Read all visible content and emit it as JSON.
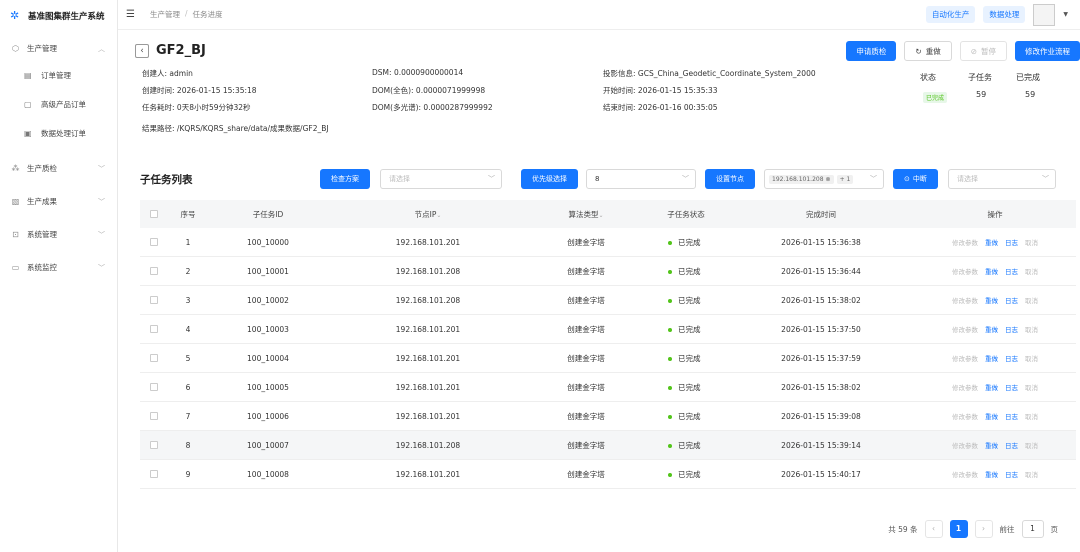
{
  "app": {
    "name": "基准图集群生产系统"
  },
  "sidebar": {
    "items": [
      {
        "label": "生产管理",
        "expanded": true,
        "children": [
          {
            "label": "订单管理"
          },
          {
            "label": "高级产品订单"
          },
          {
            "label": "数据处理订单"
          }
        ]
      },
      {
        "label": "生产质检"
      },
      {
        "label": "生产成果"
      },
      {
        "label": "系统管理"
      },
      {
        "label": "系统监控"
      }
    ]
  },
  "topbar": {
    "breadcrumb": [
      "生产管理",
      "任务进度"
    ],
    "separator": "/",
    "auto_produce": "自动化生产",
    "data_process": "数据处理"
  },
  "task": {
    "title": "GF2_BJ",
    "actions": {
      "apply_qc": "申请质检",
      "reset": "重做",
      "pause": "暂停",
      "modify": "修改作业流程"
    },
    "info": {
      "creator_label": "创建人:",
      "creator": "admin",
      "dsm_label": "DSM:",
      "dsm": "0.0000900000014",
      "proj_label": "投影信息:",
      "proj": "GCS_China_Geodetic_Coordinate_System_2000",
      "created_label": "创建时间:",
      "created": "2026-01-15 15:35:18",
      "dom_pan_label": "DOM(全色):",
      "dom_pan": "0.0000071999998",
      "start_label": "开始时间:",
      "start": "2026-01-15 15:35:33",
      "duration_label": "任务耗时:",
      "duration": "0天8小时59分钟32秒",
      "dom_ms_label": "DOM(多光谱):",
      "dom_ms": "0.0000287999992",
      "end_label": "结束时间:",
      "end": "2026-01-16 00:35:05",
      "result_label": "结果路径:",
      "result": "/KQRS/KQRS_share/data/成果数据/GF2_BJ"
    },
    "stats": {
      "status_label": "状态",
      "status": "已完成",
      "sub_label": "子任务",
      "sub": "59",
      "done_label": "已完成",
      "done": "59"
    }
  },
  "subtasks": {
    "title": "子任务列表",
    "filters": {
      "scheme_btn": "检查方案",
      "scheme_ph": "请选择",
      "priority_btn": "优先级选择",
      "priority_val": "8",
      "node_btn": "设置节点",
      "node_chip": "192.168.101.208",
      "node_more": "+ 1",
      "interrupt_btn": "中断",
      "interrupt_ph": "请选择"
    },
    "columns": [
      "序号",
      "子任务ID",
      "节点IP",
      "算法类型",
      "子任务状态",
      "完成时间",
      "操作"
    ],
    "ops": {
      "modify": "修改参数",
      "redo": "重做",
      "log": "日志",
      "cancel": "取消"
    },
    "rows": [
      {
        "idx": "1",
        "id": "100_10000",
        "ip": "192.168.101.201",
        "alg": "创建金字塔",
        "status": "已完成",
        "time": "2026-01-15 15:36:38"
      },
      {
        "idx": "2",
        "id": "100_10001",
        "ip": "192.168.101.208",
        "alg": "创建金字塔",
        "status": "已完成",
        "time": "2026-01-15 15:36:44"
      },
      {
        "idx": "3",
        "id": "100_10002",
        "ip": "192.168.101.208",
        "alg": "创建金字塔",
        "status": "已完成",
        "time": "2026-01-15 15:38:02"
      },
      {
        "idx": "4",
        "id": "100_10003",
        "ip": "192.168.101.201",
        "alg": "创建金字塔",
        "status": "已完成",
        "time": "2026-01-15 15:37:50"
      },
      {
        "idx": "5",
        "id": "100_10004",
        "ip": "192.168.101.201",
        "alg": "创建金字塔",
        "status": "已完成",
        "time": "2026-01-15 15:37:59"
      },
      {
        "idx": "6",
        "id": "100_10005",
        "ip": "192.168.101.201",
        "alg": "创建金字塔",
        "status": "已完成",
        "time": "2026-01-15 15:38:02"
      },
      {
        "idx": "7",
        "id": "100_10006",
        "ip": "192.168.101.201",
        "alg": "创建金字塔",
        "status": "已完成",
        "time": "2026-01-15 15:39:08"
      },
      {
        "idx": "8",
        "id": "100_10007",
        "ip": "192.168.101.208",
        "alg": "创建金字塔",
        "status": "已完成",
        "time": "2026-01-15 15:39:14"
      },
      {
        "idx": "9",
        "id": "100_10008",
        "ip": "192.168.101.201",
        "alg": "创建金字塔",
        "status": "已完成",
        "time": "2026-01-15 15:40:17"
      }
    ]
  },
  "pagination": {
    "total": "共 59 条",
    "current": "1",
    "goto_label": "前往",
    "goto_value": "1",
    "page_unit": "页"
  },
  "colors": {
    "primary": "#1677ff",
    "success": "#52c41a"
  }
}
